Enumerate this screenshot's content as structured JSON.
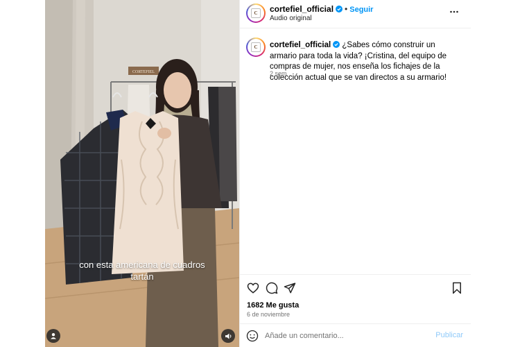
{
  "post": {
    "username": "cortefiel_official",
    "follow_label": "Seguir",
    "separator": "•",
    "audio": "Audio original",
    "brand_mark": "C",
    "caption_text": "¿Sabes cómo construir un armario para toda la vida? ¡Cristina, del equipo de compras de mujer, nos enseña los fichajes de la colección actual que se van directos a su armario!",
    "caption_time": "2 sem",
    "likes": "1682 Me gusta",
    "date": "6 de noviembre",
    "comment_placeholder": "Añade un comentario...",
    "publish_label": "Publicar"
  },
  "video": {
    "overlay_line1": "con esta americana de cuadros",
    "overlay_line2": "tartán",
    "store_sign": "CORTEFIEL"
  },
  "icons": {
    "more": "more-options-icon",
    "like": "heart-icon",
    "comment": "comment-icon",
    "share": "share-icon",
    "save": "bookmark-icon",
    "emoji": "emoji-icon",
    "tagged_user": "user-icon",
    "sound": "speaker-icon"
  },
  "colors": {
    "link": "#0095f6",
    "verified": "#0095f6",
    "muted": "#737373",
    "publish_disabled": "#8ec9f9"
  }
}
